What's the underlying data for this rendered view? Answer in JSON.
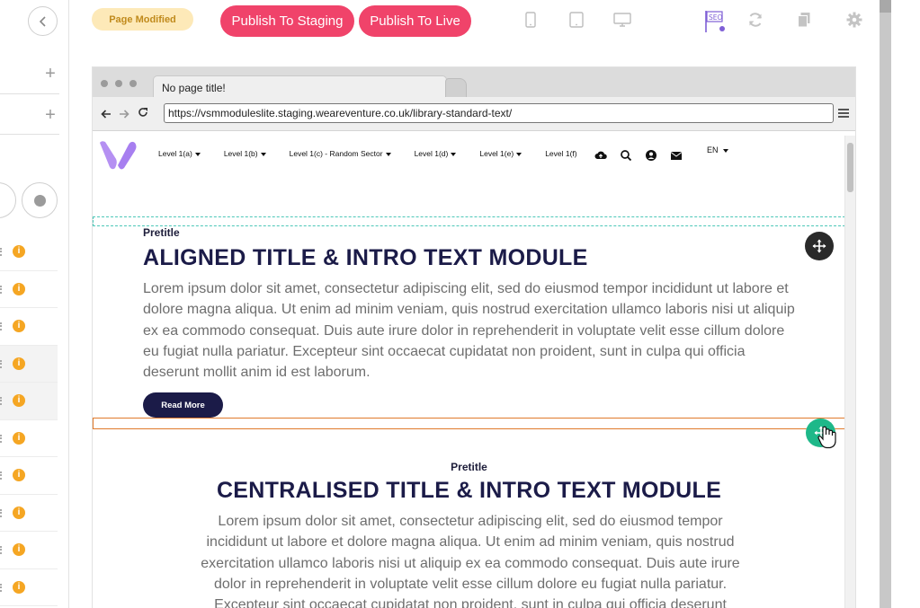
{
  "toolbar": {
    "status_badge": "Page Modified",
    "publish_staging_label": "Publish To Staging",
    "publish_live_label": "Publish To Live",
    "icons": [
      "mobile-icon",
      "tablet-icon",
      "desktop-icon",
      "seo-icon",
      "refresh-icon",
      "copy-icon",
      "gear-icon"
    ],
    "seo_label": "SEO"
  },
  "sidebar": {
    "rows_count_visible": 10,
    "info_glyph": "i"
  },
  "browser": {
    "tab_title": "No page title!",
    "url": "https://vsmmoduleslite.staging.weareventure.co.uk/library-standard-text/"
  },
  "site": {
    "nav": [
      "Level 1(a)",
      "Level 1(b)",
      "Level 1(c) - Random Sector",
      "Level 1(d)",
      "Level 1(e)",
      "Level 1(f)"
    ],
    "nav_carets": [
      true,
      true,
      true,
      true,
      true,
      false
    ],
    "language": "EN",
    "module1": {
      "pretitle": "Pretitle",
      "title": "ALIGNED TITLE & INTRO TEXT MODULE",
      "body": "Lorem ipsum dolor sit amet, consectetur adipiscing elit, sed do eiusmod tempor incididunt ut labore et dolore magna aliqua. Ut enim ad minim veniam, quis nostrud exercitation ullamco laboris nisi ut aliquip ex ea commodo consequat. Duis aute irure dolor in reprehenderit in voluptate velit esse cillum dolore eu fugiat nulla pariatur. Excepteur sint occaecat cupidatat non proident, sunt in culpa qui officia deserunt mollit anim id est laborum.",
      "button": "Read More"
    },
    "module2": {
      "pretitle": "Pretitle",
      "title": "CENTRALISED TITLE & INTRO TEXT MODULE",
      "body": "Lorem ipsum dolor sit amet, consectetur adipiscing elit, sed do eiusmod tempor incididunt ut labore et dolore magna aliqua. Ut enim ad minim veniam, quis nostrud exercitation ullamco laboris nisi ut aliquip ex ea commodo consequat. Duis aute irure dolor in reprehenderit in voluptate velit esse cillum dolore eu fugiat nulla pariatur. Excepteur sint occaecat cupidatat non proident, sunt in culpa qui officia deserunt"
    }
  },
  "colors": {
    "publish": "#f0436a",
    "badge_bg": "#fde9b8",
    "navy": "#1b1b48",
    "logo": "#b08cf0",
    "drag_green": "#1eb889",
    "selection_orange": "#e07a2b",
    "selection_teal": "#4cc7b8"
  }
}
